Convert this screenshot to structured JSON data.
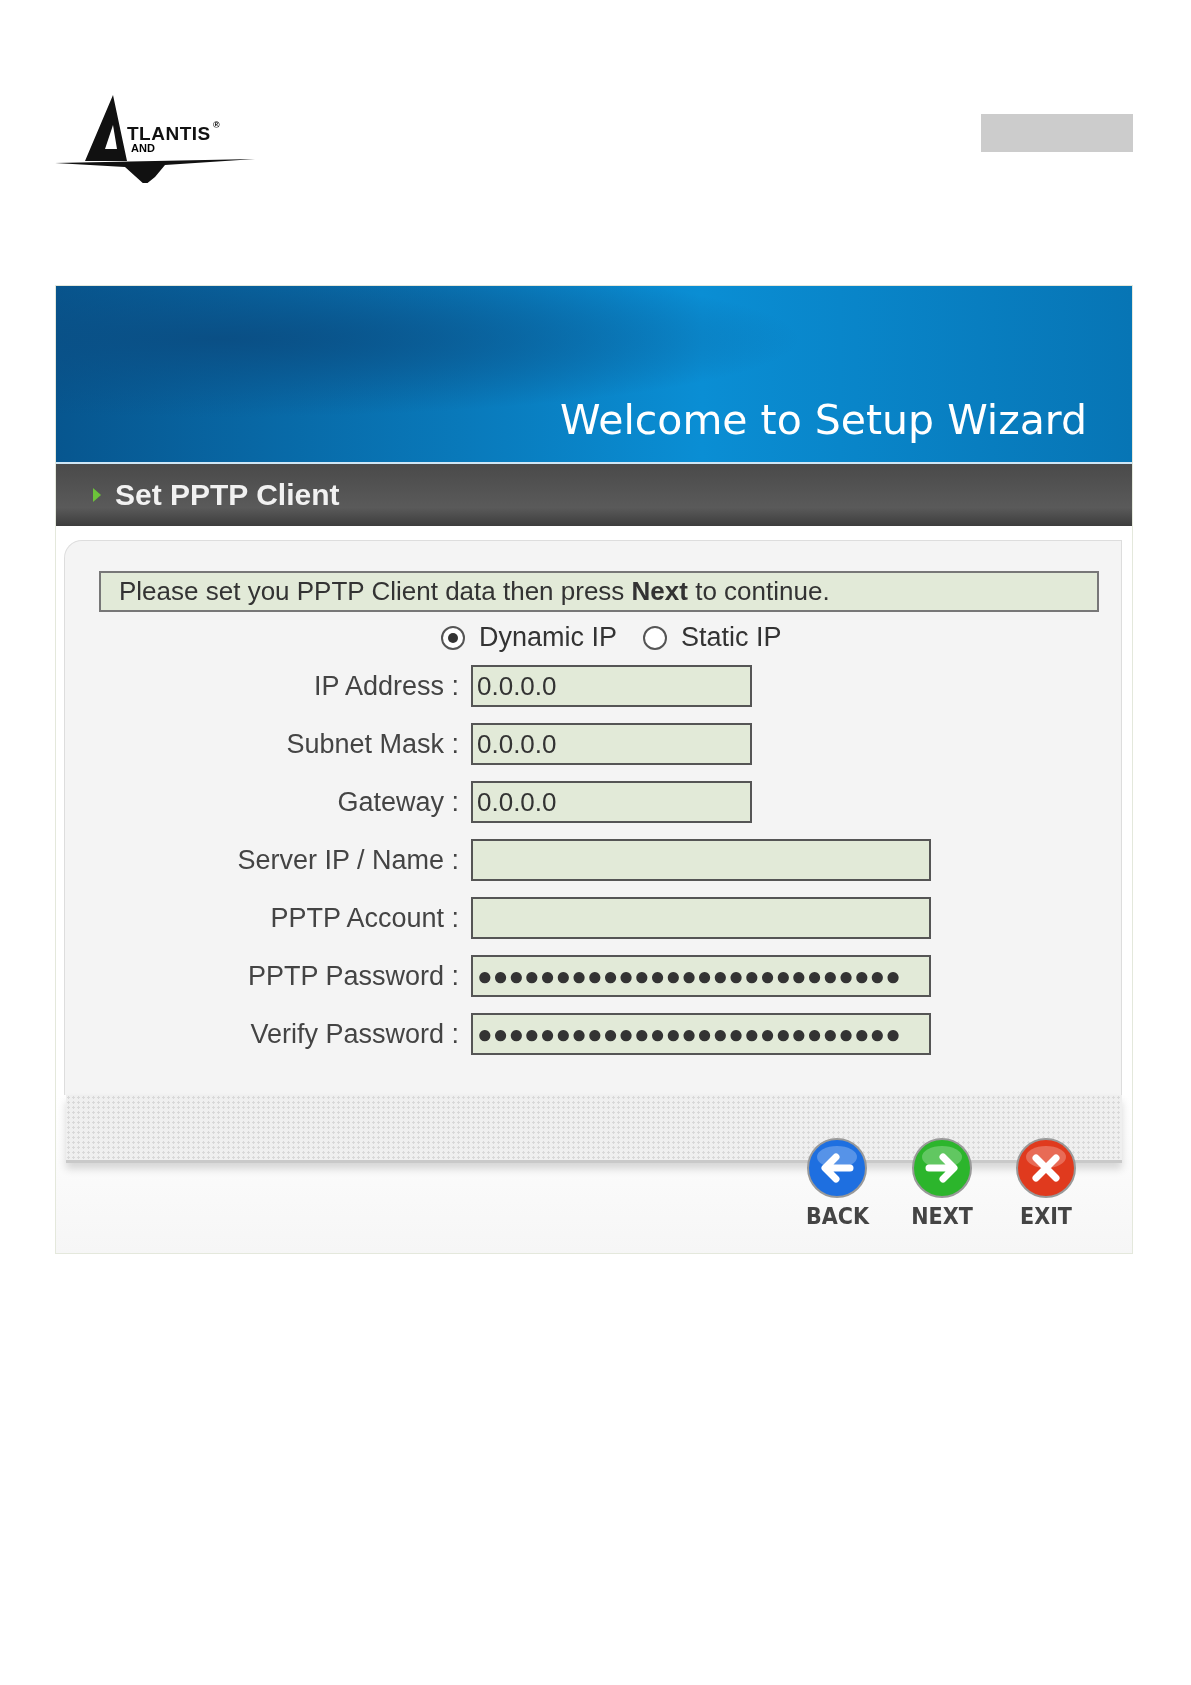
{
  "logo": {
    "word": "TLANTIS",
    "mark": "®",
    "sub": "AND"
  },
  "wizard": {
    "banner_title": "Welcome to Setup Wizard",
    "section_title": "Set PPTP Client",
    "notice": "Please set you PPTP Client data then press **Next** to continue.",
    "ip_modes": [
      {
        "label": "Dynamic IP",
        "selected": true
      },
      {
        "label": "Static IP",
        "selected": false
      }
    ],
    "fields": [
      {
        "label": "IP Address :",
        "value": "0.0.0.0",
        "wide": false
      },
      {
        "label": "Subnet Mask :",
        "value": "0.0.0.0",
        "wide": false
      },
      {
        "label": "Gateway :",
        "value": "0.0.0.0",
        "wide": false
      },
      {
        "label": "Server IP / Name :",
        "wide": true
      },
      {
        "label": "PPTP Account :",
        "wide": true
      },
      {
        "label": "PPTP Password :",
        "value": "●●●●●●●●●●●●●●●●●●●●●●●●●●●",
        "wide": true
      },
      {
        "label": "Verify Password :",
        "value": "●●●●●●●●●●●●●●●●●●●●●●●●●●●",
        "wide": true
      }
    ],
    "buttons": [
      {
        "label": "BACK",
        "kind": "back"
      },
      {
        "label": "NEXT",
        "kind": "next"
      },
      {
        "label": "EXIT",
        "kind": "exit"
      }
    ]
  }
}
